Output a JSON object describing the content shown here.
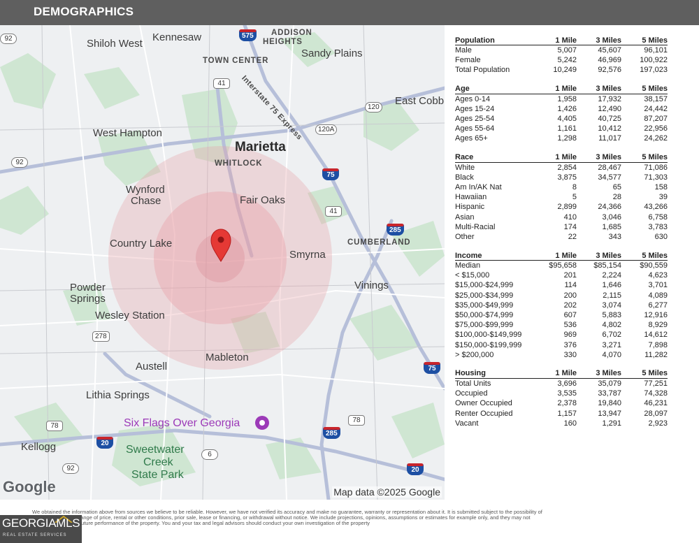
{
  "header": {
    "title": "DEMOGRAPHICS"
  },
  "map": {
    "places": [
      "Kennesaw",
      "Shiloh West",
      "ADDISON",
      "HEIGHTS",
      "Sandy Plains",
      "TOWN CENTER",
      "East Cobb",
      "West Hampton",
      "Marietta",
      "WHITLOCK",
      "Wynford",
      "Chase",
      "Fair Oaks",
      "Country Lake",
      "Smyrna",
      "CUMBERLAND",
      "Powder",
      "Springs",
      "Vinings",
      "Wesley Station",
      "Austell",
      "Mableton",
      "Lithia Springs",
      "Six Flags Over Georgia",
      "Kellogg",
      "Sweetwater",
      "Creek",
      "State Park",
      "Interstate 75 Express"
    ],
    "shields": [
      "92",
      "575",
      "41",
      "120",
      "120A",
      "92",
      "75",
      "41",
      "285",
      "278",
      "75",
      "78",
      "20",
      "78",
      "285",
      "6",
      "92",
      "20"
    ],
    "google_logo": "Google",
    "credit": "Map data ©2025 Google",
    "colors": {
      "marker": "#e53935",
      "ring": "#e8a0a8"
    }
  },
  "tables": {
    "population": {
      "headers": [
        "Population",
        "1 Mile",
        "3 Miles",
        "5 Miles"
      ],
      "rows": [
        [
          "Male",
          "5,007",
          "45,607",
          "96,101"
        ],
        [
          "Female",
          "5,242",
          "46,969",
          "100,922"
        ],
        [
          "Total Population",
          "10,249",
          "92,576",
          "197,023"
        ]
      ]
    },
    "age": {
      "headers": [
        "Age",
        "1 Mile",
        "3 Miles",
        "5 Miles"
      ],
      "rows": [
        [
          "Ages 0-14",
          "1,958",
          "17,932",
          "38,157"
        ],
        [
          "Ages 15-24",
          "1,426",
          "12,490",
          "24,442"
        ],
        [
          "Ages 25-54",
          "4,405",
          "40,725",
          "87,207"
        ],
        [
          "Ages 55-64",
          "1,161",
          "10,412",
          "22,956"
        ],
        [
          "Ages 65+",
          "1,298",
          "11,017",
          "24,262"
        ]
      ]
    },
    "race": {
      "headers": [
        "Race",
        "1 Mile",
        "3 Miles",
        "5 Miles"
      ],
      "rows": [
        [
          "White",
          "2,854",
          "28,467",
          "71,086"
        ],
        [
          "Black",
          "3,875",
          "34,577",
          "71,303"
        ],
        [
          "Am In/AK Nat",
          "8",
          "65",
          "158"
        ],
        [
          "Hawaiian",
          "5",
          "28",
          "39"
        ],
        [
          "Hispanic",
          "2,899",
          "24,366",
          "43,266"
        ],
        [
          "Asian",
          "410",
          "3,046",
          "6,758"
        ],
        [
          "Multi-Racial",
          "174",
          "1,685",
          "3,783"
        ],
        [
          "Other",
          "22",
          "343",
          "630"
        ]
      ]
    },
    "income": {
      "headers": [
        "Income",
        "1 Mile",
        "3 Miles",
        "5 Miles"
      ],
      "rows": [
        [
          "Median",
          "$95,658",
          "$85,154",
          "$90,559"
        ],
        [
          "< $15,000",
          "201",
          "2,224",
          "4,623"
        ],
        [
          "$15,000-$24,999",
          "114",
          "1,646",
          "3,701"
        ],
        [
          "$25,000-$34,999",
          "200",
          "2,115",
          "4,089"
        ],
        [
          "$35,000-$49,999",
          "202",
          "3,074",
          "6,277"
        ],
        [
          "$50,000-$74,999",
          "607",
          "5,883",
          "12,916"
        ],
        [
          "$75,000-$99,999",
          "536",
          "4,802",
          "8,929"
        ],
        [
          "$100,000-$149,999",
          "969",
          "6,702",
          "14,612"
        ],
        [
          "$150,000-$199,999",
          "376",
          "3,271",
          "7,898"
        ],
        [
          "> $200,000",
          "330",
          "4,070",
          "11,282"
        ]
      ]
    },
    "housing": {
      "headers": [
        "Housing",
        "1 Mile",
        "3 Miles",
        "5 Miles"
      ],
      "rows": [
        [
          "Total Units",
          "3,696",
          "35,079",
          "77,251"
        ],
        [
          "Occupied",
          "3,535",
          "33,787",
          "74,328"
        ],
        [
          "Owner Occupied",
          "2,378",
          "19,840",
          "46,231"
        ],
        [
          "Renter Occupied",
          "1,157",
          "13,947",
          "28,097"
        ],
        [
          "Vacant",
          "160",
          "1,291",
          "2,923"
        ]
      ]
    }
  },
  "disclaimer": "We obtained the information above from sources we believe to be reliable. However, we have not verified its accuracy and make no guarantee, warranty or representation about it. It is submitted subject to the possibility of errors, omissions, change of price, rental or other conditions, prior sale, lease or financing, or withdrawal without notice. We include projections, opinions, assumptions or estimates for example only, and they may not represent current or future performance of the property. You and your tax and legal advisors should conduct your own investigation of the property",
  "logo": {
    "text": "GEORGIAMLS",
    "subtitle": "REAL ESTATE SERVICES"
  }
}
